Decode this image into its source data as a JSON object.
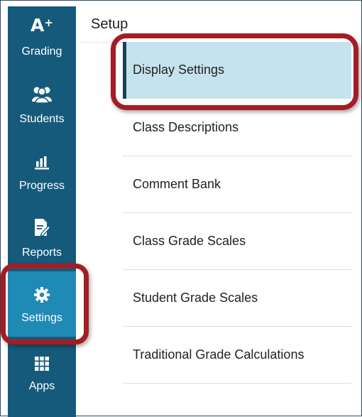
{
  "sidebar": {
    "items": [
      {
        "label": "Grading",
        "icon": "a-plus-icon",
        "icon_text": "A",
        "icon_sup": "+"
      },
      {
        "label": "Students",
        "icon": "users-icon"
      },
      {
        "label": "Progress",
        "icon": "bar-chart-icon"
      },
      {
        "label": "Reports",
        "icon": "document-edit-icon"
      },
      {
        "label": "Settings",
        "icon": "gear-icon",
        "active": true
      },
      {
        "label": "Apps",
        "icon": "grid-icon"
      }
    ]
  },
  "setup": {
    "title": "Setup",
    "menu": [
      {
        "label": "Display Settings",
        "active": true
      },
      {
        "label": "Class Descriptions"
      },
      {
        "label": "Comment Bank"
      },
      {
        "label": "Class Grade Scales"
      },
      {
        "label": "Student Grade Scales"
      },
      {
        "label": "Traditional Grade Calculations"
      }
    ]
  },
  "colors": {
    "sidebar_bg": "#155a7a",
    "sidebar_active": "#1f8ab5",
    "active_item_bg": "#c5e3ef",
    "highlight_border": "#a51c23"
  }
}
